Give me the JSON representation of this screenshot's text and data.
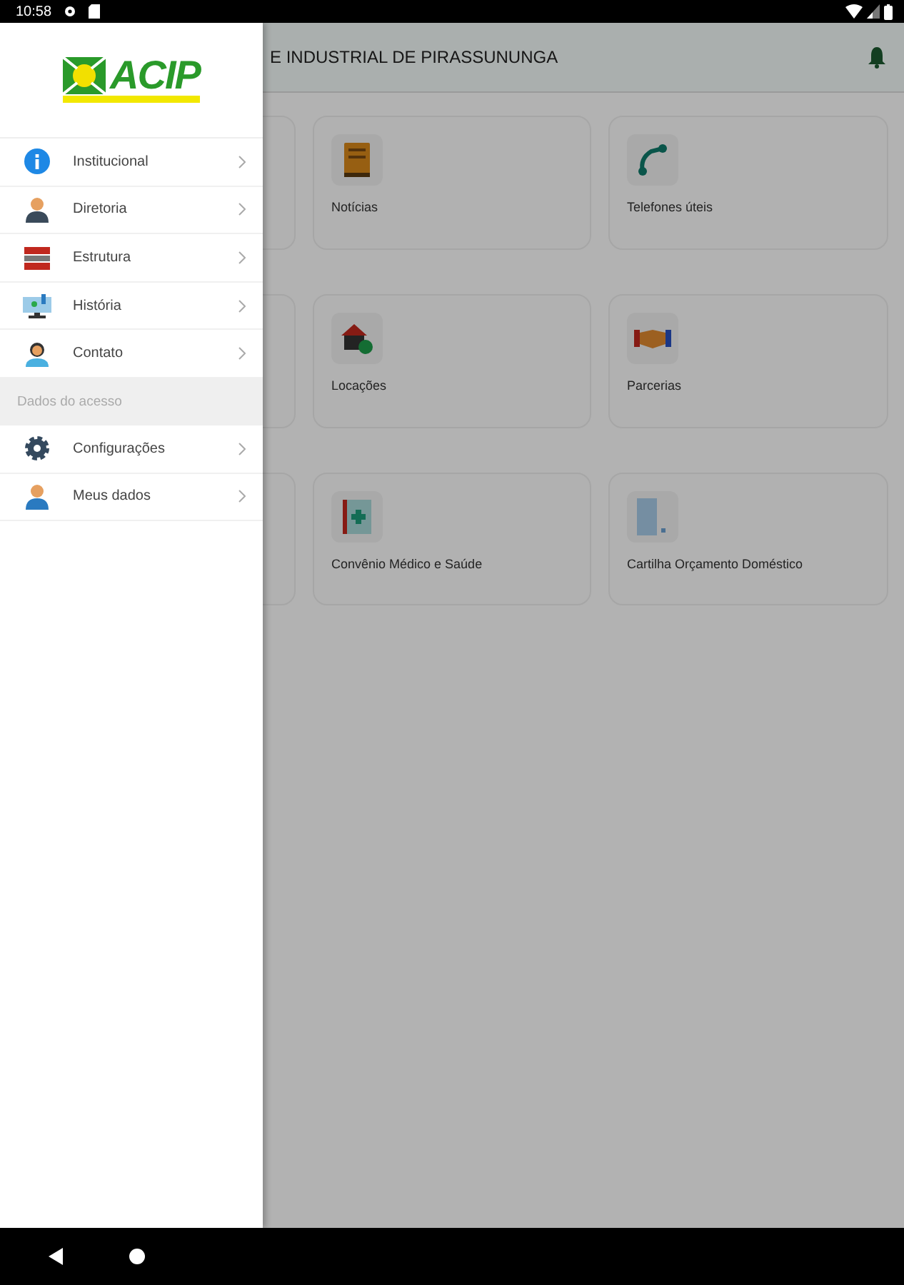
{
  "status_bar": {
    "time": "10:58"
  },
  "app_bar": {
    "title": "E INDUSTRIAL DE PIRASSUNUNGA"
  },
  "cards": [
    {
      "label": "Notícias"
    },
    {
      "label": "Telefones úteis"
    },
    {
      "label": "Locações"
    },
    {
      "label": "Parcerias"
    },
    {
      "label": "Convênio Médico e Saúde"
    },
    {
      "label": "Cartilha Orçamento Doméstico"
    }
  ],
  "drawer": {
    "logo": {
      "text": "ACIP"
    },
    "items": [
      {
        "kind": "item",
        "label": "Institucional"
      },
      {
        "kind": "item",
        "label": "Diretoria"
      },
      {
        "kind": "item",
        "label": "Estrutura"
      },
      {
        "kind": "item",
        "label": "História"
      },
      {
        "kind": "item",
        "label": "Contato"
      },
      {
        "kind": "header",
        "label": "Dados do acesso"
      },
      {
        "kind": "item",
        "label": "Configurações"
      },
      {
        "kind": "item",
        "label": "Meus dados"
      }
    ]
  }
}
